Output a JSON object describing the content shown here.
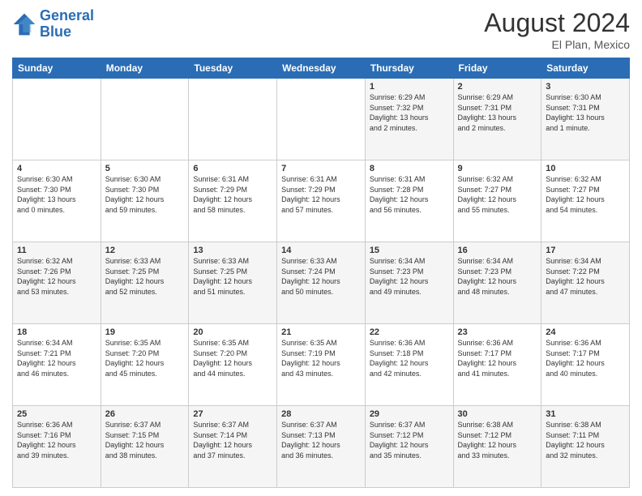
{
  "header": {
    "logo_line1": "General",
    "logo_line2": "Blue",
    "month_year": "August 2024",
    "location": "El Plan, Mexico"
  },
  "weekdays": [
    "Sunday",
    "Monday",
    "Tuesday",
    "Wednesday",
    "Thursday",
    "Friday",
    "Saturday"
  ],
  "weeks": [
    [
      {
        "day": "",
        "detail": ""
      },
      {
        "day": "",
        "detail": ""
      },
      {
        "day": "",
        "detail": ""
      },
      {
        "day": "",
        "detail": ""
      },
      {
        "day": "1",
        "detail": "Sunrise: 6:29 AM\nSunset: 7:32 PM\nDaylight: 13 hours\nand 2 minutes."
      },
      {
        "day": "2",
        "detail": "Sunrise: 6:29 AM\nSunset: 7:31 PM\nDaylight: 13 hours\nand 2 minutes."
      },
      {
        "day": "3",
        "detail": "Sunrise: 6:30 AM\nSunset: 7:31 PM\nDaylight: 13 hours\nand 1 minute."
      }
    ],
    [
      {
        "day": "4",
        "detail": "Sunrise: 6:30 AM\nSunset: 7:30 PM\nDaylight: 13 hours\nand 0 minutes."
      },
      {
        "day": "5",
        "detail": "Sunrise: 6:30 AM\nSunset: 7:30 PM\nDaylight: 12 hours\nand 59 minutes."
      },
      {
        "day": "6",
        "detail": "Sunrise: 6:31 AM\nSunset: 7:29 PM\nDaylight: 12 hours\nand 58 minutes."
      },
      {
        "day": "7",
        "detail": "Sunrise: 6:31 AM\nSunset: 7:29 PM\nDaylight: 12 hours\nand 57 minutes."
      },
      {
        "day": "8",
        "detail": "Sunrise: 6:31 AM\nSunset: 7:28 PM\nDaylight: 12 hours\nand 56 minutes."
      },
      {
        "day": "9",
        "detail": "Sunrise: 6:32 AM\nSunset: 7:27 PM\nDaylight: 12 hours\nand 55 minutes."
      },
      {
        "day": "10",
        "detail": "Sunrise: 6:32 AM\nSunset: 7:27 PM\nDaylight: 12 hours\nand 54 minutes."
      }
    ],
    [
      {
        "day": "11",
        "detail": "Sunrise: 6:32 AM\nSunset: 7:26 PM\nDaylight: 12 hours\nand 53 minutes."
      },
      {
        "day": "12",
        "detail": "Sunrise: 6:33 AM\nSunset: 7:25 PM\nDaylight: 12 hours\nand 52 minutes."
      },
      {
        "day": "13",
        "detail": "Sunrise: 6:33 AM\nSunset: 7:25 PM\nDaylight: 12 hours\nand 51 minutes."
      },
      {
        "day": "14",
        "detail": "Sunrise: 6:33 AM\nSunset: 7:24 PM\nDaylight: 12 hours\nand 50 minutes."
      },
      {
        "day": "15",
        "detail": "Sunrise: 6:34 AM\nSunset: 7:23 PM\nDaylight: 12 hours\nand 49 minutes."
      },
      {
        "day": "16",
        "detail": "Sunrise: 6:34 AM\nSunset: 7:23 PM\nDaylight: 12 hours\nand 48 minutes."
      },
      {
        "day": "17",
        "detail": "Sunrise: 6:34 AM\nSunset: 7:22 PM\nDaylight: 12 hours\nand 47 minutes."
      }
    ],
    [
      {
        "day": "18",
        "detail": "Sunrise: 6:34 AM\nSunset: 7:21 PM\nDaylight: 12 hours\nand 46 minutes."
      },
      {
        "day": "19",
        "detail": "Sunrise: 6:35 AM\nSunset: 7:20 PM\nDaylight: 12 hours\nand 45 minutes."
      },
      {
        "day": "20",
        "detail": "Sunrise: 6:35 AM\nSunset: 7:20 PM\nDaylight: 12 hours\nand 44 minutes."
      },
      {
        "day": "21",
        "detail": "Sunrise: 6:35 AM\nSunset: 7:19 PM\nDaylight: 12 hours\nand 43 minutes."
      },
      {
        "day": "22",
        "detail": "Sunrise: 6:36 AM\nSunset: 7:18 PM\nDaylight: 12 hours\nand 42 minutes."
      },
      {
        "day": "23",
        "detail": "Sunrise: 6:36 AM\nSunset: 7:17 PM\nDaylight: 12 hours\nand 41 minutes."
      },
      {
        "day": "24",
        "detail": "Sunrise: 6:36 AM\nSunset: 7:17 PM\nDaylight: 12 hours\nand 40 minutes."
      }
    ],
    [
      {
        "day": "25",
        "detail": "Sunrise: 6:36 AM\nSunset: 7:16 PM\nDaylight: 12 hours\nand 39 minutes."
      },
      {
        "day": "26",
        "detail": "Sunrise: 6:37 AM\nSunset: 7:15 PM\nDaylight: 12 hours\nand 38 minutes."
      },
      {
        "day": "27",
        "detail": "Sunrise: 6:37 AM\nSunset: 7:14 PM\nDaylight: 12 hours\nand 37 minutes."
      },
      {
        "day": "28",
        "detail": "Sunrise: 6:37 AM\nSunset: 7:13 PM\nDaylight: 12 hours\nand 36 minutes."
      },
      {
        "day": "29",
        "detail": "Sunrise: 6:37 AM\nSunset: 7:12 PM\nDaylight: 12 hours\nand 35 minutes."
      },
      {
        "day": "30",
        "detail": "Sunrise: 6:38 AM\nSunset: 7:12 PM\nDaylight: 12 hours\nand 33 minutes."
      },
      {
        "day": "31",
        "detail": "Sunrise: 6:38 AM\nSunset: 7:11 PM\nDaylight: 12 hours\nand 32 minutes."
      }
    ]
  ]
}
